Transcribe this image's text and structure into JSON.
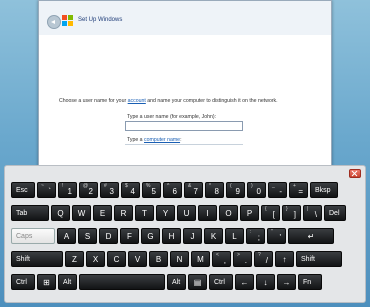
{
  "setup_window": {
    "title": "Set Up Windows",
    "prompt_before_link": "Choose a user name for your ",
    "prompt_link": "account",
    "prompt_after_link": " and name your computer to distinguish it on the network.",
    "username_label": "Type a user name (for example, John):",
    "username_value": "",
    "computer_name_prefix": "Type a ",
    "computer_name_link": "computer name",
    "computer_name_suffix": ":"
  },
  "keyboard": {
    "row1": [
      {
        "label": "Esc"
      },
      {
        "shift": "~",
        "main": "`"
      },
      {
        "shift": "!",
        "main": "1"
      },
      {
        "shift": "@",
        "main": "2"
      },
      {
        "shift": "#",
        "main": "3"
      },
      {
        "shift": "$",
        "main": "4"
      },
      {
        "shift": "%",
        "main": "5"
      },
      {
        "shift": "^",
        "main": "6"
      },
      {
        "shift": "&",
        "main": "7"
      },
      {
        "shift": "*",
        "main": "8"
      },
      {
        "shift": "(",
        "main": "9"
      },
      {
        "shift": ")",
        "main": "0"
      },
      {
        "shift": "_",
        "main": "-"
      },
      {
        "shift": "+",
        "main": "="
      },
      {
        "label": "Bksp"
      }
    ],
    "row2": [
      {
        "label": "Tab"
      },
      {
        "label": "Q"
      },
      {
        "label": "W"
      },
      {
        "label": "E"
      },
      {
        "label": "R"
      },
      {
        "label": "T"
      },
      {
        "label": "Y"
      },
      {
        "label": "U"
      },
      {
        "label": "I"
      },
      {
        "label": "O"
      },
      {
        "label": "P"
      },
      {
        "shift": "{",
        "main": "["
      },
      {
        "shift": "}",
        "main": "]"
      },
      {
        "shift": "|",
        "main": "\\"
      },
      {
        "label": "Del"
      }
    ],
    "row3": [
      {
        "label": "Caps"
      },
      {
        "label": "A"
      },
      {
        "label": "S"
      },
      {
        "label": "D"
      },
      {
        "label": "F"
      },
      {
        "label": "G"
      },
      {
        "label": "H"
      },
      {
        "label": "J"
      },
      {
        "label": "K"
      },
      {
        "label": "L"
      },
      {
        "shift": ":",
        "main": ";"
      },
      {
        "shift": "\"",
        "main": "'"
      },
      {
        "label": "↵"
      }
    ],
    "row4": [
      {
        "label": "Shift"
      },
      {
        "label": "Z"
      },
      {
        "label": "X"
      },
      {
        "label": "C"
      },
      {
        "label": "V"
      },
      {
        "label": "B"
      },
      {
        "label": "N"
      },
      {
        "label": "M"
      },
      {
        "shift": "<",
        "main": ","
      },
      {
        "shift": ">",
        "main": "."
      },
      {
        "shift": "?",
        "main": "/"
      },
      {
        "label": "↑"
      },
      {
        "label": "Shift"
      }
    ],
    "row5": [
      {
        "label": "Ctrl"
      },
      {
        "label": "⊞"
      },
      {
        "label": "Alt"
      },
      {
        "label": ""
      },
      {
        "label": "Alt"
      },
      {
        "label": "▤"
      },
      {
        "label": "Ctrl"
      },
      {
        "label": "←"
      },
      {
        "label": "↓"
      },
      {
        "label": "→"
      },
      {
        "label": "Fn"
      }
    ]
  },
  "colors": {
    "key_dark": "#121315",
    "key_caps": "#f0f0f0",
    "link": "#1a5fb4",
    "close": "#c8412d"
  }
}
